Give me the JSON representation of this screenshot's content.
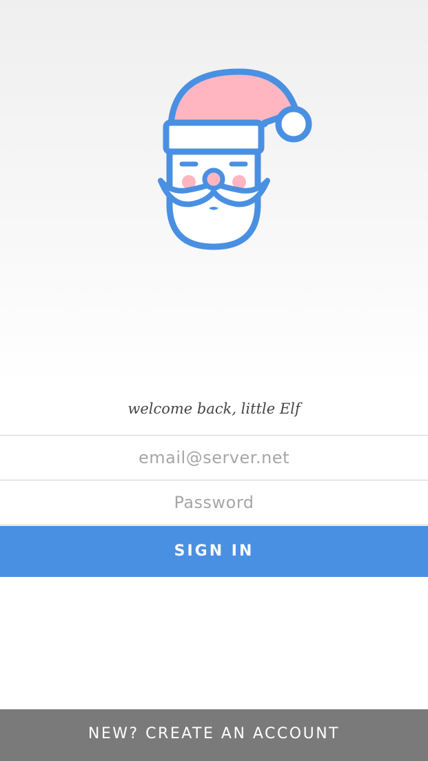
{
  "header": {
    "logo_icon": "santa-face-icon"
  },
  "welcome": {
    "text": "welcome back, little Elf"
  },
  "form": {
    "email_placeholder": "email@server.net",
    "password_placeholder": "Password",
    "signin_label": "SIGN IN"
  },
  "footer": {
    "create_account_label": "NEW? CREATE AN ACCOUNT"
  },
  "colors": {
    "accent": "#4a90e2",
    "hat_pink": "#ffb6c1",
    "footer_gray": "#7a7a7a",
    "placeholder_gray": "#a6a6a6"
  }
}
